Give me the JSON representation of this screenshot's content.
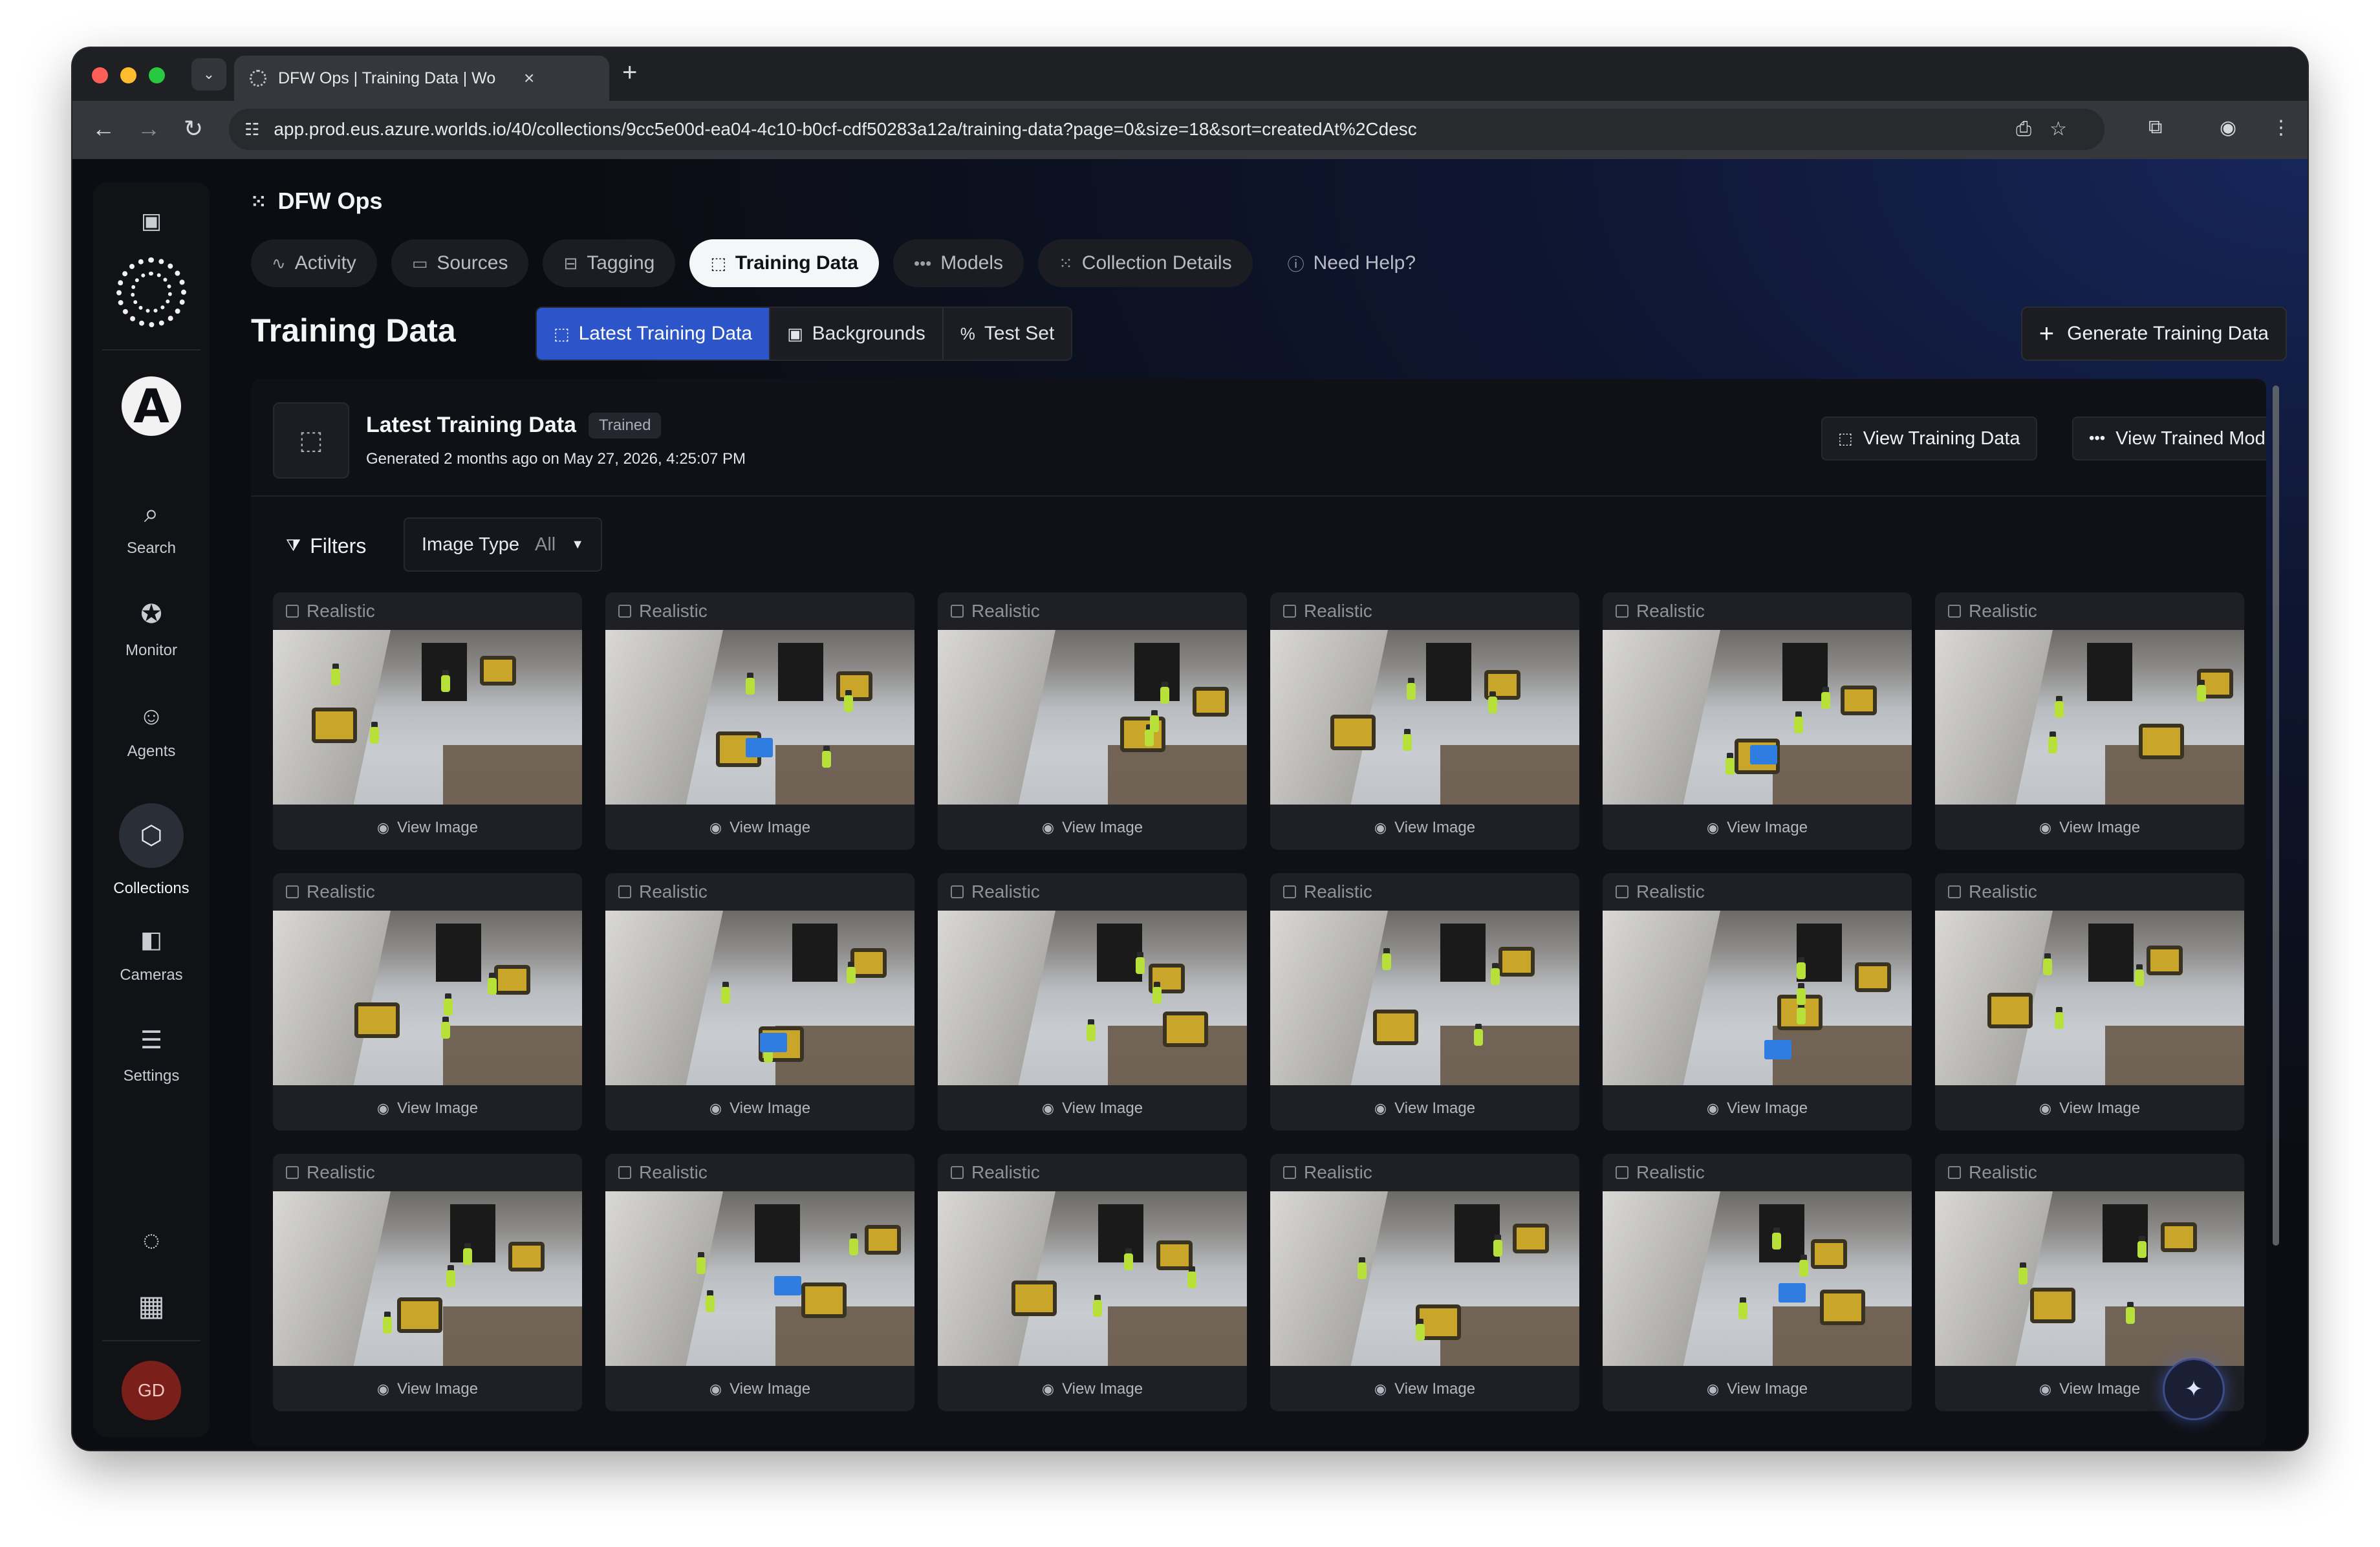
{
  "browser": {
    "tab_title": "DFW Ops | Training Data | Wo",
    "url": "app.prod.eus.azure.worlds.io/40/collections/9cc5e00d-ea04-4c10-b0cf-cdf50283a12a/training-data?page=0&size=18&sort=createdAt%2Cdesc",
    "colors": {
      "close": "#ff5f57",
      "minimize": "#febc2e",
      "zoom": "#28c840"
    }
  },
  "sidebar": {
    "items": [
      {
        "label": "Search",
        "icon": "search-icon"
      },
      {
        "label": "Monitor",
        "icon": "monitor-icon"
      },
      {
        "label": "Agents",
        "icon": "robot-icon"
      },
      {
        "label": "Collections",
        "icon": "collections-icon"
      },
      {
        "label": "Cameras",
        "icon": "camera-icon"
      },
      {
        "label": "Settings",
        "icon": "sliders-icon"
      }
    ],
    "logo_letter": "A",
    "avatar_initials": "GD"
  },
  "header": {
    "org": "DFW Ops",
    "tabs": [
      {
        "label": "Activity",
        "icon": "activity-icon"
      },
      {
        "label": "Sources",
        "icon": "sources-icon"
      },
      {
        "label": "Tagging",
        "icon": "tag-icon"
      },
      {
        "label": "Training Data",
        "icon": "training-icon",
        "active": true
      },
      {
        "label": "Models",
        "icon": "models-icon"
      },
      {
        "label": "Collection Details",
        "icon": "grid-icon"
      }
    ],
    "help": "Need Help?"
  },
  "page": {
    "title": "Training Data",
    "segments": [
      {
        "label": "Latest Training Data",
        "active": true
      },
      {
        "label": "Backgrounds"
      },
      {
        "label": "Test Set"
      }
    ],
    "generate_button": "Generate Training Data",
    "accent_color": "#2c55c9"
  },
  "panel": {
    "title": "Latest Training Data",
    "badge": "Trained",
    "subtitle": "Generated 2 months ago on May 27, 2026, 4:25:07 PM",
    "view_data_button": "View Training Data",
    "view_model_button": "View Trained Model",
    "filters_label": "Filters",
    "filter": {
      "name": "Image Type",
      "value": "All"
    }
  },
  "images": {
    "type_label": "Realistic",
    "action_label": "View Image",
    "count": 18
  }
}
